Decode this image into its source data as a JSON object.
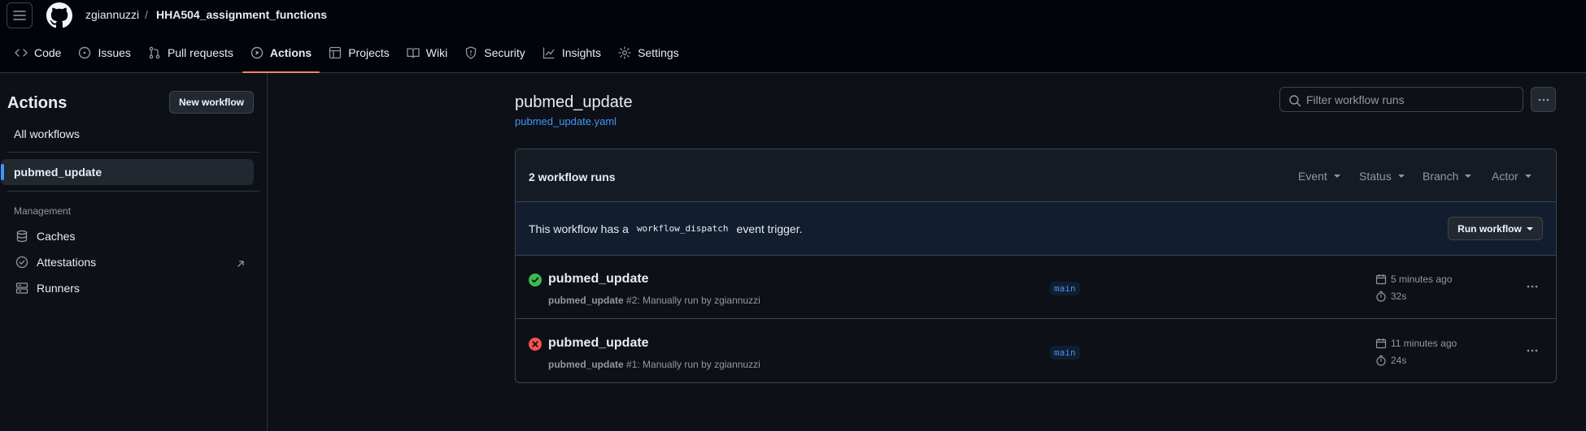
{
  "header": {
    "owner": "zgiannuzzi",
    "separator": "/",
    "repo": "HHA504_assignment_functions"
  },
  "tabs": [
    {
      "label": "Code",
      "icon": "code-icon"
    },
    {
      "label": "Issues",
      "icon": "issue-icon"
    },
    {
      "label": "Pull requests",
      "icon": "pull-request-icon"
    },
    {
      "label": "Actions",
      "icon": "play-icon",
      "selected": true
    },
    {
      "label": "Projects",
      "icon": "table-icon"
    },
    {
      "label": "Wiki",
      "icon": "book-icon"
    },
    {
      "label": "Security",
      "icon": "shield-icon"
    },
    {
      "label": "Insights",
      "icon": "graph-icon"
    },
    {
      "label": "Settings",
      "icon": "gear-icon"
    }
  ],
  "sidebar": {
    "title": "Actions",
    "new_workflow_label": "New workflow",
    "all_workflows_label": "All workflows",
    "active_workflow": "pubmed_update",
    "management_heading": "Management",
    "management_items": [
      {
        "label": "Caches",
        "icon": "database-icon"
      },
      {
        "label": "Attestations",
        "icon": "verified-icon"
      },
      {
        "label": "Runners",
        "icon": "server-icon"
      }
    ]
  },
  "main": {
    "title": "pubmed_update",
    "file": "pubmed_update.yaml",
    "filter_placeholder": "Filter workflow runs",
    "runs_count": "2 workflow runs",
    "filters": [
      "Event",
      "Status",
      "Branch",
      "Actor"
    ],
    "dispatch": {
      "prefix": "This workflow has a",
      "code": "workflow_dispatch",
      "suffix": "event trigger."
    },
    "run_workflow_label": "Run workflow",
    "runs": [
      {
        "status": "success",
        "title": "pubmed_update",
        "workflow": "pubmed_update",
        "detail": "#2: Manually run by zgiannuzzi",
        "branch": "main",
        "when": "5 minutes ago",
        "duration": "32s"
      },
      {
        "status": "failure",
        "title": "pubmed_update",
        "workflow": "pubmed_update",
        "detail": "#1: Manually run by zgiannuzzi",
        "branch": "main",
        "when": "11 minutes ago",
        "duration": "24s"
      }
    ]
  },
  "colors": {
    "accent": "#4493f8",
    "success": "#3fb950",
    "failure": "#f85149",
    "tab_underline": "#f78166"
  }
}
